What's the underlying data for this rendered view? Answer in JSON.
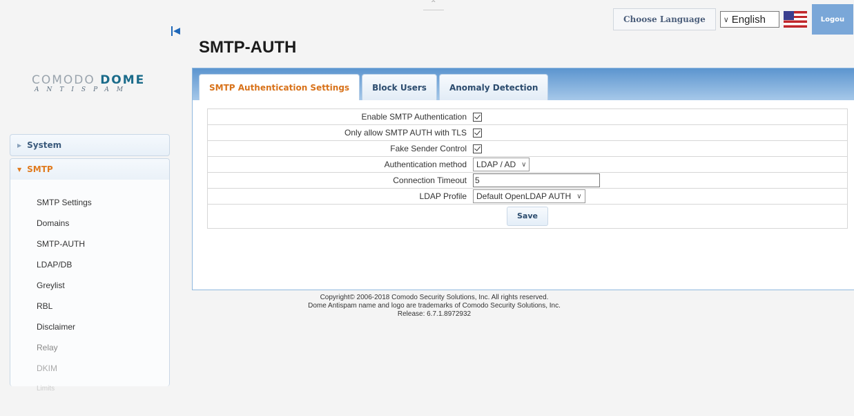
{
  "header": {
    "choose_language": "Choose Language",
    "language_value": "English",
    "logout": "Logou"
  },
  "logo": {
    "line1a": "COMODO",
    "line1b": "DOME",
    "line2": "ANTISPAM"
  },
  "sidebar": {
    "system_label": "System",
    "smtp_label": "SMTP",
    "items": [
      "SMTP Settings",
      "Domains",
      "SMTP-AUTH",
      "LDAP/DB",
      "Greylist",
      "RBL",
      "Disclaimer",
      "Relay",
      "DKIM",
      "Limits"
    ]
  },
  "page": {
    "title": "SMTP-AUTH"
  },
  "tabs": [
    "SMTP Authentication Settings",
    "Block Users",
    "Anomaly Detection"
  ],
  "form": {
    "enable_label": "Enable SMTP Authentication",
    "tls_label": "Only allow SMTP AUTH with TLS",
    "fake_label": "Fake Sender Control",
    "method_label": "Authentication method",
    "method_value": "LDAP / AD",
    "timeout_label": "Connection Timeout",
    "timeout_value": "5",
    "ldap_label": "LDAP Profile",
    "ldap_value": "Default OpenLDAP AUTH",
    "save": "Save"
  },
  "footer": {
    "line1": "Copyright© 2006-2018 Comodo Security Solutions, Inc. All rights reserved.",
    "line2": "Dome Antispam name and logo are trademarks of Comodo Security Solutions, Inc.",
    "line3": "Release: 6.7.1.8972932"
  }
}
